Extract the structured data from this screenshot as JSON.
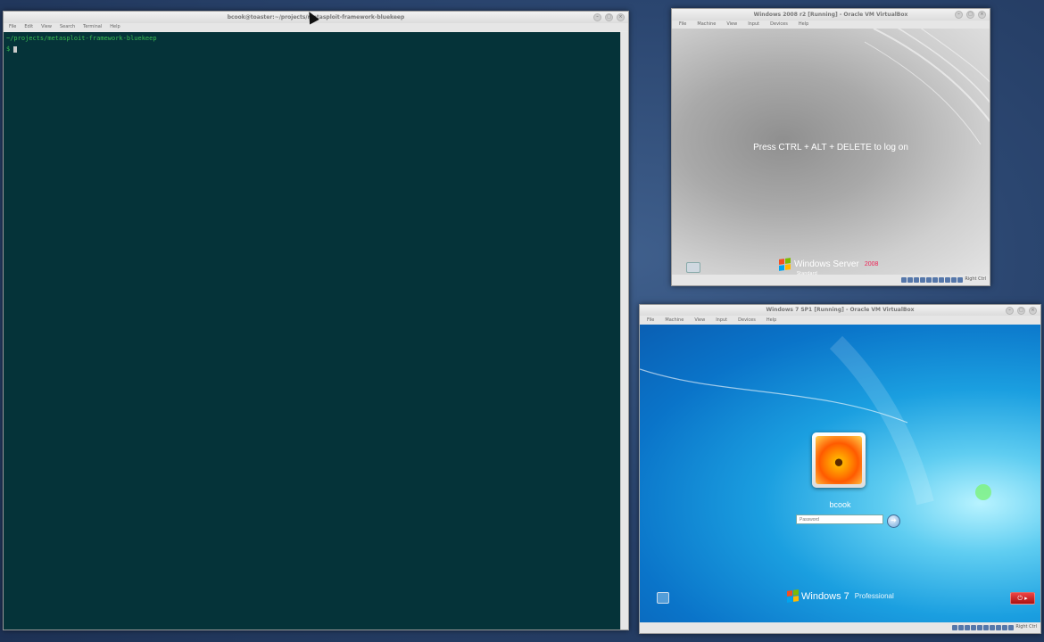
{
  "terminal": {
    "title": "bcook@toaster:~/projects/metasploit-framework-bluekeep",
    "menu": [
      "File",
      "Edit",
      "View",
      "Search",
      "Terminal",
      "Help"
    ],
    "path_line": "~/projects/metasploit-framework-bluekeep",
    "prompt": "$"
  },
  "vbox_server": {
    "title": "Windows 2008 r2 [Running] - Oracle VM VirtualBox",
    "menu": [
      "File",
      "Machine",
      "View",
      "Input",
      "Devices",
      "Help"
    ],
    "message": "Press CTRL + ALT + DELETE to log on",
    "os_name": "Windows Server",
    "os_version": "2008",
    "os_edition": "Standard",
    "host_key": "Right Ctrl"
  },
  "vbox_win7": {
    "title": "Windows 7 SP1 [Running] - Oracle VM VirtualBox",
    "menu": [
      "File",
      "Machine",
      "View",
      "Input",
      "Devices",
      "Help"
    ],
    "username": "bcook",
    "password_placeholder": "Password",
    "os_name": "Windows",
    "os_version": "7",
    "os_edition": "Professional",
    "host_key": "Right Ctrl"
  },
  "colors": {
    "terminal_bg": "#053339",
    "terminal_text": "#3bbf52",
    "desktop_bg": "#2b4670"
  }
}
